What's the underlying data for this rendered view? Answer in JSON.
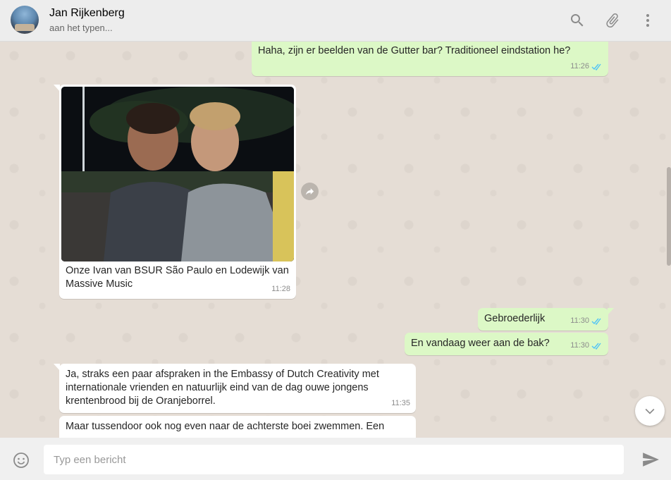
{
  "header": {
    "contact_name": "Jan Rijkenberg",
    "status": "aan het typen...",
    "icons": [
      "search-icon",
      "attach-icon",
      "menu-icon"
    ]
  },
  "messages": [
    {
      "direction": "out",
      "text": "Haha, zijn er beelden van de Gutter bar? Traditioneel eindstation he?",
      "time": "11:26",
      "status": "read"
    },
    {
      "direction": "in",
      "type": "image",
      "caption": "Onze Ivan van BSUR São Paulo en Lodewijk van\nMassive Music",
      "time": "11:28"
    },
    {
      "direction": "out",
      "text": "Gebroederlijk",
      "time": "11:30",
      "status": "read"
    },
    {
      "direction": "out",
      "text": "En vandaag weer aan de bak?",
      "time": "11:30",
      "status": "read"
    },
    {
      "direction": "in",
      "text": "Ja, straks een paar afspraken in the Embassy of Dutch Creativity met\ninternationale vrienden en natuurlijk eind van de dag ouwe jongens\nkrentenbrood bij de Oranjeborrel.",
      "time": "11:35"
    },
    {
      "direction": "in",
      "text": "Maar tussendoor ook nog even naar de achterste boei zwemmen. Een",
      "time": ""
    }
  ],
  "composer": {
    "placeholder": "Typ een bericht"
  },
  "colors": {
    "outgoing_bubble": "#dcf8c6",
    "incoming_bubble": "#ffffff",
    "chat_background": "#e5ddd5",
    "read_ticks": "#4fc3f7"
  }
}
